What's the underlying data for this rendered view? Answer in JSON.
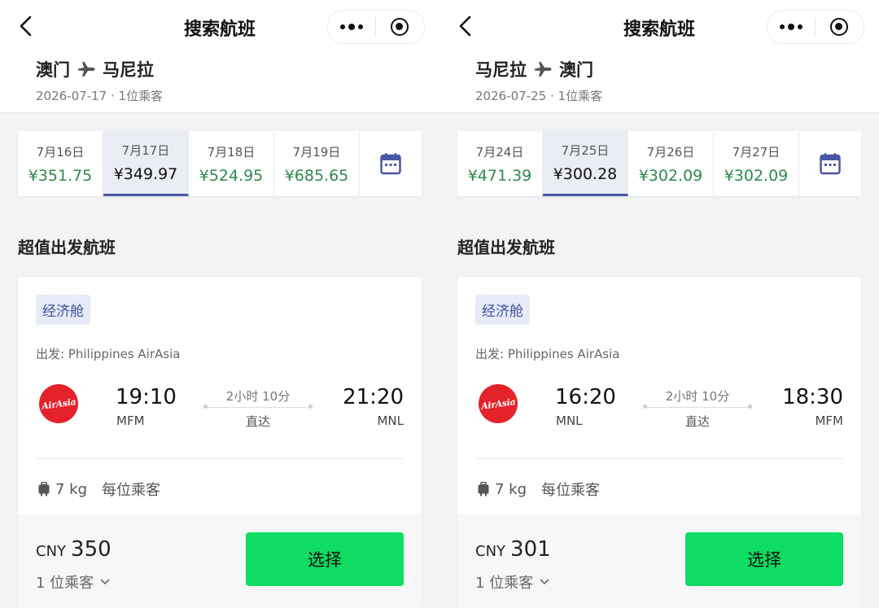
{
  "colors": {
    "accent": "#4a56a6",
    "price_green": "#2c8a4a",
    "button_green": "#0fdc62",
    "airline_red": "#e4222a"
  },
  "panels": [
    {
      "nav_title": "搜索航班",
      "origin": "澳门",
      "destination": "马尼拉",
      "date": "2026-07-17",
      "separator": "·",
      "passengers": "1位乘客",
      "dates": [
        {
          "label": "7月16日",
          "price": "¥351.75",
          "selected": false
        },
        {
          "label": "7月17日",
          "price": "¥349.97",
          "selected": true
        },
        {
          "label": "7月18日",
          "price": "¥524.95",
          "selected": false
        },
        {
          "label": "7月19日",
          "price": "¥685.65",
          "selected": false
        }
      ],
      "section_title": "超值出发航班",
      "flight": {
        "cabin": "经济舱",
        "departure_label": "出发: Philippines AirAsia",
        "airline_logo_text": "AirAsia",
        "dep_time": "19:10",
        "dep_code": "MFM",
        "duration": "2小时 10分",
        "stops": "直达",
        "arr_time": "21:20",
        "arr_code": "MNL",
        "baggage": "7 kg",
        "baggage_note": "每位乘客",
        "currency": "CNY",
        "price": "350",
        "pax_select": "1 位乘客",
        "select_button": "选择"
      }
    },
    {
      "nav_title": "搜索航班",
      "origin": "马尼拉",
      "destination": "澳门",
      "date": "2026-07-25",
      "separator": "·",
      "passengers": "1位乘客",
      "dates": [
        {
          "label": "7月24日",
          "price": "¥471.39",
          "selected": false
        },
        {
          "label": "7月25日",
          "price": "¥300.28",
          "selected": true
        },
        {
          "label": "7月26日",
          "price": "¥302.09",
          "selected": false
        },
        {
          "label": "7月27日",
          "price": "¥302.09",
          "selected": false
        }
      ],
      "section_title": "超值出发航班",
      "flight": {
        "cabin": "经济舱",
        "departure_label": "出发: Philippines AirAsia",
        "airline_logo_text": "AirAsia",
        "dep_time": "16:20",
        "dep_code": "MNL",
        "duration": "2小时 10分",
        "stops": "直达",
        "arr_time": "18:30",
        "arr_code": "MFM",
        "baggage": "7 kg",
        "baggage_note": "每位乘客",
        "currency": "CNY",
        "price": "301",
        "pax_select": "1 位乘客",
        "select_button": "选择"
      }
    }
  ]
}
